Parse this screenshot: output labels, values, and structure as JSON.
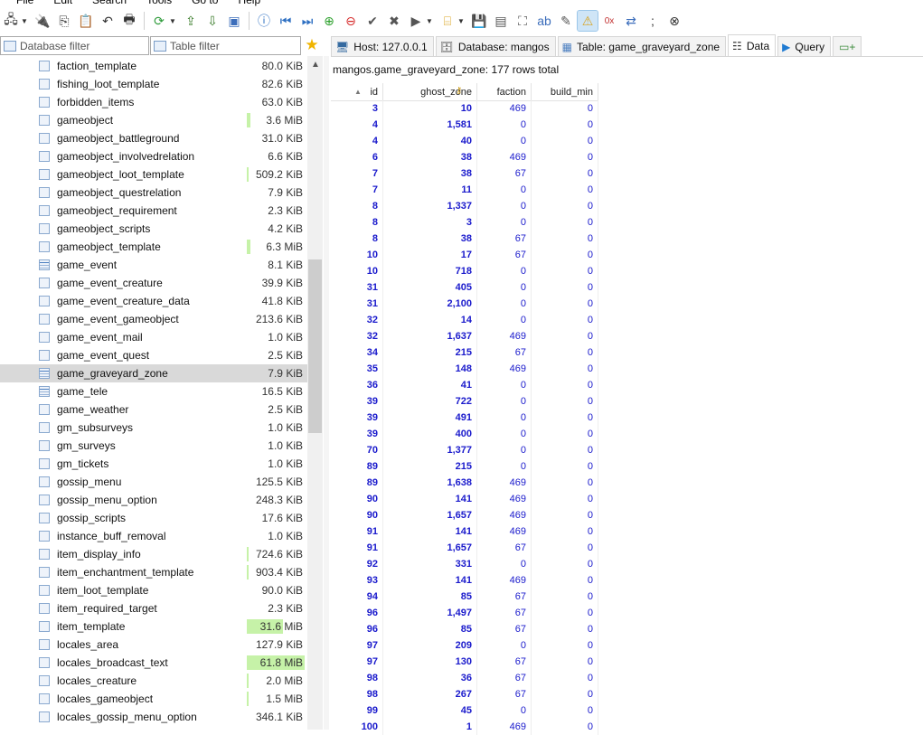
{
  "menu": [
    "File",
    "Edit",
    "Search",
    "Tools",
    "Go to",
    "Help"
  ],
  "toolbar": {
    "icons": [
      "connect-icon",
      "dropdown-icon",
      "disconnect-icon",
      "copy-icon",
      "paste-icon",
      "undo-icon",
      "print-icon",
      "refresh-icon",
      "dropdown-icon",
      "export-icon",
      "import-icon",
      "help-icon",
      "first-icon",
      "last-icon",
      "add-icon",
      "remove-icon",
      "post-icon",
      "cancel-icon",
      "run-icon",
      "dropdown-icon",
      "filter-icon",
      "dropdown-icon",
      "save-icon",
      "save-all-icon",
      "binoculars-icon",
      "replace-icon",
      "edit-icon",
      "warning-icon",
      "stop-icon",
      "format-icon",
      "wrap-icon",
      "semicolon-icon",
      "close-icon"
    ]
  },
  "filters": {
    "database_placeholder": "Database filter",
    "table_placeholder": "Table filter"
  },
  "tabs": [
    {
      "label": "Host: 127.0.0.1",
      "icon": "host-icon"
    },
    {
      "label": "Database: mangos",
      "icon": "database-icon"
    },
    {
      "label": "Table: game_graveyard_zone",
      "icon": "table-icon"
    },
    {
      "label": "Data",
      "icon": "data-icon"
    },
    {
      "label": "Query",
      "icon": "play-icon"
    },
    {
      "label": "",
      "icon": "new-query-icon"
    }
  ],
  "tree": [
    {
      "name": "faction_template",
      "size": "80.0 KiB",
      "bar": "none"
    },
    {
      "name": "fishing_loot_template",
      "size": "82.6 KiB",
      "bar": "none"
    },
    {
      "name": "forbidden_items",
      "size": "63.0 KiB",
      "bar": "none"
    },
    {
      "name": "gameobject",
      "size": "3.6 MiB",
      "bar": "small"
    },
    {
      "name": "gameobject_battleground",
      "size": "31.0 KiB",
      "bar": "none"
    },
    {
      "name": "gameobject_involvedrelation",
      "size": "6.6 KiB",
      "bar": "none"
    },
    {
      "name": "gameobject_loot_template",
      "size": "509.2 KiB",
      "bar": "thin"
    },
    {
      "name": "gameobject_questrelation",
      "size": "7.9 KiB",
      "bar": "none"
    },
    {
      "name": "gameobject_requirement",
      "size": "2.3 KiB",
      "bar": "none"
    },
    {
      "name": "gameobject_scripts",
      "size": "4.2 KiB",
      "bar": "none"
    },
    {
      "name": "gameobject_template",
      "size": "6.3 MiB",
      "bar": "small"
    },
    {
      "name": "game_event",
      "size": "8.1 KiB",
      "bar": "none",
      "icon": "grid"
    },
    {
      "name": "game_event_creature",
      "size": "39.9 KiB",
      "bar": "none"
    },
    {
      "name": "game_event_creature_data",
      "size": "41.8 KiB",
      "bar": "none"
    },
    {
      "name": "game_event_gameobject",
      "size": "213.6 KiB",
      "bar": "none"
    },
    {
      "name": "game_event_mail",
      "size": "1.0 KiB",
      "bar": "none"
    },
    {
      "name": "game_event_quest",
      "size": "2.5 KiB",
      "bar": "none"
    },
    {
      "name": "game_graveyard_zone",
      "size": "7.9 KiB",
      "bar": "none",
      "selected": true,
      "icon": "grid"
    },
    {
      "name": "game_tele",
      "size": "16.5 KiB",
      "bar": "none",
      "icon": "grid"
    },
    {
      "name": "game_weather",
      "size": "2.5 KiB",
      "bar": "none"
    },
    {
      "name": "gm_subsurveys",
      "size": "1.0 KiB",
      "bar": "none"
    },
    {
      "name": "gm_surveys",
      "size": "1.0 KiB",
      "bar": "none"
    },
    {
      "name": "gm_tickets",
      "size": "1.0 KiB",
      "bar": "none"
    },
    {
      "name": "gossip_menu",
      "size": "125.5 KiB",
      "bar": "none"
    },
    {
      "name": "gossip_menu_option",
      "size": "248.3 KiB",
      "bar": "none"
    },
    {
      "name": "gossip_scripts",
      "size": "17.6 KiB",
      "bar": "none"
    },
    {
      "name": "instance_buff_removal",
      "size": "1.0 KiB",
      "bar": "none"
    },
    {
      "name": "item_display_info",
      "size": "724.6 KiB",
      "bar": "thin"
    },
    {
      "name": "item_enchantment_template",
      "size": "903.4 KiB",
      "bar": "thin"
    },
    {
      "name": "item_loot_template",
      "size": "90.0 KiB",
      "bar": "none"
    },
    {
      "name": "item_required_target",
      "size": "2.3 KiB",
      "bar": "none"
    },
    {
      "name": "item_template",
      "size": "31.6 MiB",
      "bar": "medium"
    },
    {
      "name": "locales_area",
      "size": "127.9 KiB",
      "bar": "none"
    },
    {
      "name": "locales_broadcast_text",
      "size": "61.8 MiB",
      "bar": "full"
    },
    {
      "name": "locales_creature",
      "size": "2.0 MiB",
      "bar": "thin"
    },
    {
      "name": "locales_gameobject",
      "size": "1.5 MiB",
      "bar": "thin"
    },
    {
      "name": "locales_gossip_menu_option",
      "size": "346.1 KiB",
      "bar": "none"
    }
  ],
  "grid": {
    "caption": "mangos.game_graveyard_zone: 177 rows total",
    "columns": [
      "id",
      "ghost_zone",
      "faction",
      "build_min"
    ],
    "rows": [
      [
        "3",
        "10",
        "469",
        "0"
      ],
      [
        "4",
        "1,581",
        "0",
        "0"
      ],
      [
        "4",
        "40",
        "0",
        "0"
      ],
      [
        "6",
        "38",
        "469",
        "0"
      ],
      [
        "7",
        "38",
        "67",
        "0"
      ],
      [
        "7",
        "11",
        "0",
        "0"
      ],
      [
        "8",
        "1,337",
        "0",
        "0"
      ],
      [
        "8",
        "3",
        "0",
        "0"
      ],
      [
        "8",
        "38",
        "67",
        "0"
      ],
      [
        "10",
        "17",
        "67",
        "0"
      ],
      [
        "10",
        "718",
        "0",
        "0"
      ],
      [
        "31",
        "405",
        "0",
        "0"
      ],
      [
        "31",
        "2,100",
        "0",
        "0"
      ],
      [
        "32",
        "14",
        "0",
        "0"
      ],
      [
        "32",
        "1,637",
        "469",
        "0"
      ],
      [
        "34",
        "215",
        "67",
        "0"
      ],
      [
        "35",
        "148",
        "469",
        "0"
      ],
      [
        "36",
        "41",
        "0",
        "0"
      ],
      [
        "39",
        "722",
        "0",
        "0"
      ],
      [
        "39",
        "491",
        "0",
        "0"
      ],
      [
        "39",
        "400",
        "0",
        "0"
      ],
      [
        "70",
        "1,377",
        "0",
        "0"
      ],
      [
        "89",
        "215",
        "0",
        "0"
      ],
      [
        "89",
        "1,638",
        "469",
        "0"
      ],
      [
        "90",
        "141",
        "469",
        "0"
      ],
      [
        "90",
        "1,657",
        "469",
        "0"
      ],
      [
        "91",
        "141",
        "469",
        "0"
      ],
      [
        "91",
        "1,657",
        "67",
        "0"
      ],
      [
        "92",
        "331",
        "0",
        "0"
      ],
      [
        "93",
        "141",
        "469",
        "0"
      ],
      [
        "94",
        "85",
        "67",
        "0"
      ],
      [
        "96",
        "1,497",
        "67",
        "0"
      ],
      [
        "96",
        "85",
        "67",
        "0"
      ],
      [
        "97",
        "209",
        "0",
        "0"
      ],
      [
        "97",
        "130",
        "67",
        "0"
      ],
      [
        "98",
        "36",
        "67",
        "0"
      ],
      [
        "98",
        "267",
        "67",
        "0"
      ],
      [
        "99",
        "45",
        "0",
        "0"
      ],
      [
        "100",
        "1",
        "469",
        "0"
      ]
    ]
  },
  "colors": {
    "value_text": "#1a1acc",
    "size_bar": "#c6f2a8",
    "selection": "#d9d9d9",
    "active_toolbar": "#cfe5f7"
  }
}
